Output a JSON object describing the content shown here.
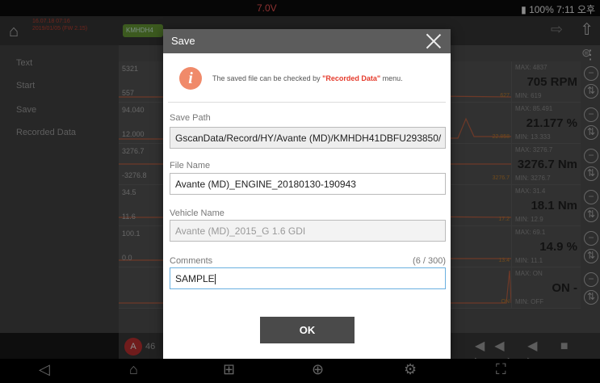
{
  "status_bar": {
    "voltage": "7.0V",
    "battery": "100%",
    "time": "7:11 오후"
  },
  "header": {
    "date_line1": "16.07.18 07:16",
    "date_line2": "2019/01/05 (FW 2.15)",
    "vin_chip": "KMHDH4"
  },
  "sidebar": {
    "items": [
      "Text",
      "Start",
      "Save",
      "Recorded Data"
    ]
  },
  "graph_rows": [
    {
      "max": "5321",
      "min": "557",
      "panel_max": "MAX: 4837",
      "value": "705 RPM",
      "panel_min": "MIN: 619",
      "trace_tag": "627"
    },
    {
      "max": "94.040",
      "min": "12.000",
      "panel_max": "MAX: 85.491",
      "value": "21.177 %",
      "panel_min": "MIN: 13.333",
      "trace_tag": "22.858"
    },
    {
      "max": "3276.7",
      "min": "-3276.8",
      "panel_max": "MAX: 3276.7",
      "value": "3276.7 Nm",
      "panel_min": "MIN: 3276.7",
      "trace_tag": "3276.7"
    },
    {
      "max": "34.5",
      "min": "11.6",
      "panel_max": "MAX: 31.4",
      "value": "18.1 Nm",
      "panel_min": "MIN: 12.9",
      "trace_tag": "17.2"
    },
    {
      "max": "100.1",
      "min": "0.0",
      "panel_max": "MAX: 69.1",
      "value": "14.9 %",
      "panel_min": "MIN: 11.1",
      "trace_tag": "13.4"
    },
    {
      "max": "",
      "min": "",
      "panel_max": "MAX: ON",
      "value": "ON -",
      "panel_min": "MIN: OFF",
      "trace_tag": "ON"
    }
  ],
  "toolbar": {
    "counter": "46"
  },
  "dialog": {
    "title": "Save",
    "info_prefix": "The saved file can be checked by ",
    "info_link": "\"Recorded Data\"",
    "info_suffix": " menu.",
    "save_path_label": "Save Path",
    "save_path_value": "GscanData/Record/HY/Avante (MD)/KMHDH41DBFU293850/",
    "file_name_label": "File Name",
    "file_name_value": "Avante (MD)_ENGINE_20180130-190943",
    "vehicle_name_label": "Vehicle Name",
    "vehicle_name_value": "Avante (MD)_2015_G 1.6 GDI",
    "comments_label": "Comments",
    "comments_counter": "(6 / 300)",
    "comments_value": "SAMPLE",
    "ok_label": "OK"
  }
}
